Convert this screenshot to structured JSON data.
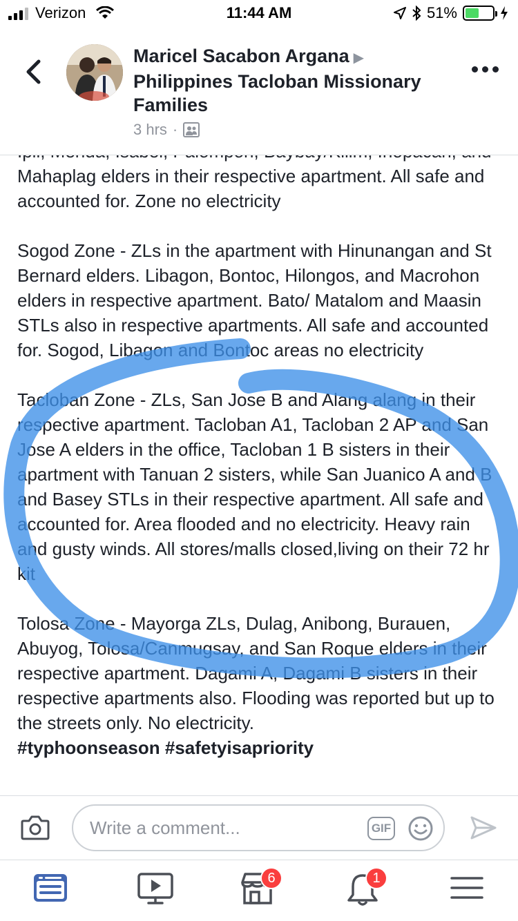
{
  "status_bar": {
    "carrier": "Verizon",
    "time": "11:44 AM",
    "battery_percent": "51%",
    "battery_level": 0.51,
    "icons": [
      "signal-icon",
      "wifi-icon",
      "location-arrow-icon",
      "bluetooth-icon",
      "battery-icon",
      "charging-icon"
    ]
  },
  "header": {
    "author": "Maricel Sacabon Argana",
    "group_line1": "Philippines Tacloban Missionary",
    "group_line2": "Families",
    "time_ago": "3 hrs",
    "separator": "·",
    "icons": [
      "back-arrow-icon",
      "avatar",
      "play-arrow-icon",
      "group-privacy-icon",
      "more-dots-icon"
    ]
  },
  "post": {
    "paragraphs": [
      "Ipil, Merida, Isabel, Palompon, Baybay/Kilim, Inopacan, and Mahaplag elders in their respective apartment. All safe and accounted for. Zone no electricity",
      "Sogod Zone - ZLs in the apartment with Hinunangan and St Bernard elders. Libagon, Bontoc, Hilongos, and Macrohon elders in respective apartment. Bato/ Matalom and Maasin STLs also in respective apartments. All safe and accounted for. Sogod, Libagon and Bontoc areas no electricity",
      "Tacloban Zone - ZLs, San Jose B and Alang alang in their respective apartment. Tacloban A1, Tacloban 2 AP and San Jose A elders in the office, Tacloban 1 B sisters in their apartment with Tanuan 2 sisters, while San Juanico A and B and Basey STLs in their respective apartment. All safe and accounted for. Area flooded and no electricity. Heavy rain and gusty winds. All stores/malls closed,living on their 72 hr kit",
      "Tolosa Zone - Mayorga ZLs, Dulag, Anibong, Burauen, Abuyog, Tolosa/Canmugsay, and San Roque elders in their respective apartment. Dagami A, Dagami B sisters in their respective apartments also. Flooding was reported but up to the streets only. No electricity."
    ],
    "hashtags": "#typhoonseason #safetyisapriority",
    "highlight_color": "#3d8fe8"
  },
  "comment_bar": {
    "placeholder": "Write a comment...",
    "gif_label": "GIF",
    "icons": [
      "camera-icon",
      "gif-icon",
      "emoji-icon",
      "send-icon"
    ]
  },
  "tab_bar": {
    "tabs": [
      {
        "name": "news-feed",
        "icon": "news-feed-icon",
        "active": true
      },
      {
        "name": "watch",
        "icon": "video-icon",
        "active": false
      },
      {
        "name": "marketplace",
        "icon": "marketplace-icon",
        "badge": "6"
      },
      {
        "name": "notifications",
        "icon": "bell-icon",
        "badge": "1"
      },
      {
        "name": "menu",
        "icon": "menu-icon",
        "active": false
      }
    ],
    "active_color": "#4267b2",
    "icon_color": "#4b4f56"
  }
}
